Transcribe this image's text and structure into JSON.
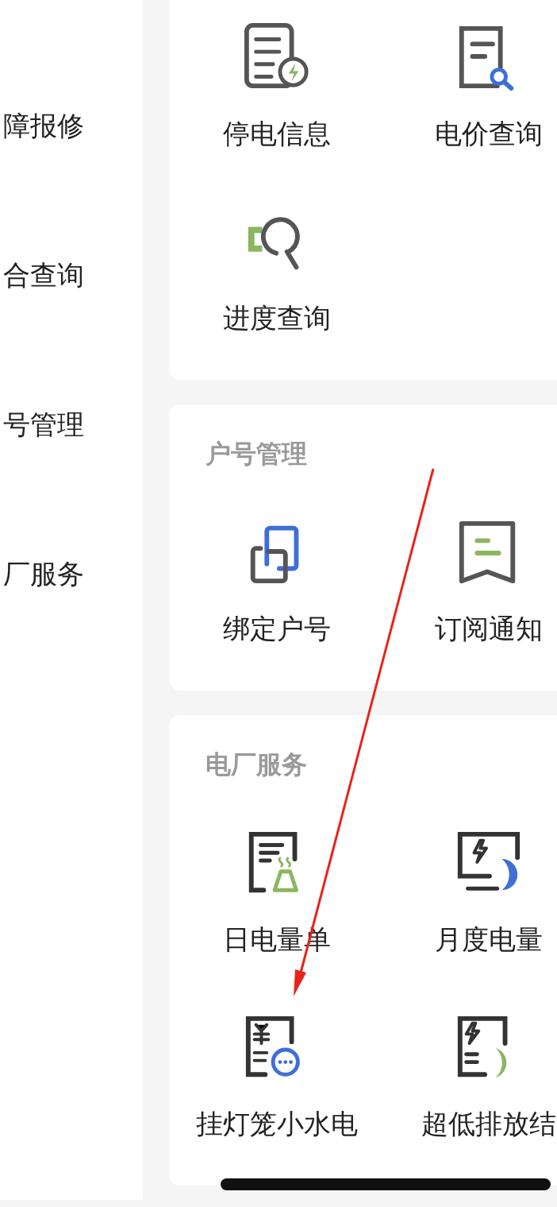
{
  "sidebar": {
    "items": [
      {
        "label": "障报修",
        "selected": false
      },
      {
        "label": "合查询",
        "selected": false
      },
      {
        "label": "号管理",
        "selected": false
      },
      {
        "label": "厂服务",
        "selected": false
      }
    ]
  },
  "sections": [
    {
      "items": [
        {
          "label": "停电信息",
          "kind": "doc-bolt"
        },
        {
          "label": "电价查询",
          "kind": "doc-search"
        },
        {
          "label": "进度查询",
          "kind": "progress-search"
        }
      ]
    },
    {
      "title": "户号管理",
      "items": [
        {
          "label": "绑定户号",
          "kind": "squares"
        },
        {
          "label": "订阅通知",
          "kind": "bookmark"
        }
      ]
    },
    {
      "title": "电厂服务",
      "items": [
        {
          "label": "日电量单",
          "kind": "doc-flask"
        },
        {
          "label": "月度电量",
          "kind": "monitor-moon"
        },
        {
          "label": "挂灯笼小水电",
          "kind": "doc-yen"
        },
        {
          "label": "超低排放结",
          "kind": "doc-moon"
        }
      ]
    }
  ],
  "annotation_arrow": true
}
